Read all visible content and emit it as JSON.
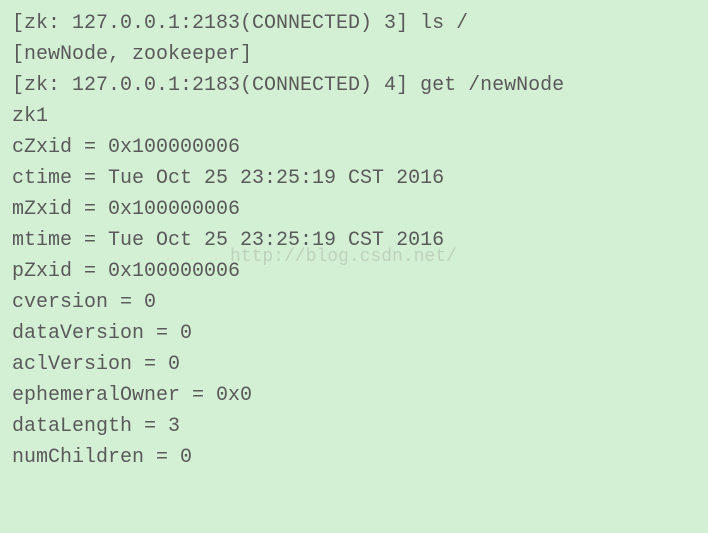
{
  "terminal": {
    "lines": [
      "[zk: 127.0.0.1:2183(CONNECTED) 3] ls /",
      "[newNode, zookeeper]",
      "[zk: 127.0.0.1:2183(CONNECTED) 4] get /newNode",
      "zk1",
      "cZxid = 0x100000006",
      "ctime = Tue Oct 25 23:25:19 CST 2016",
      "mZxid = 0x100000006",
      "mtime = Tue Oct 25 23:25:19 CST 2016",
      "pZxid = 0x100000006",
      "cversion = 0",
      "dataVersion = 0",
      "aclVersion = 0",
      "ephemeralOwner = 0x0",
      "dataLength = 3",
      "numChildren = 0"
    ]
  },
  "watermark": "http://blog.csdn.net/"
}
